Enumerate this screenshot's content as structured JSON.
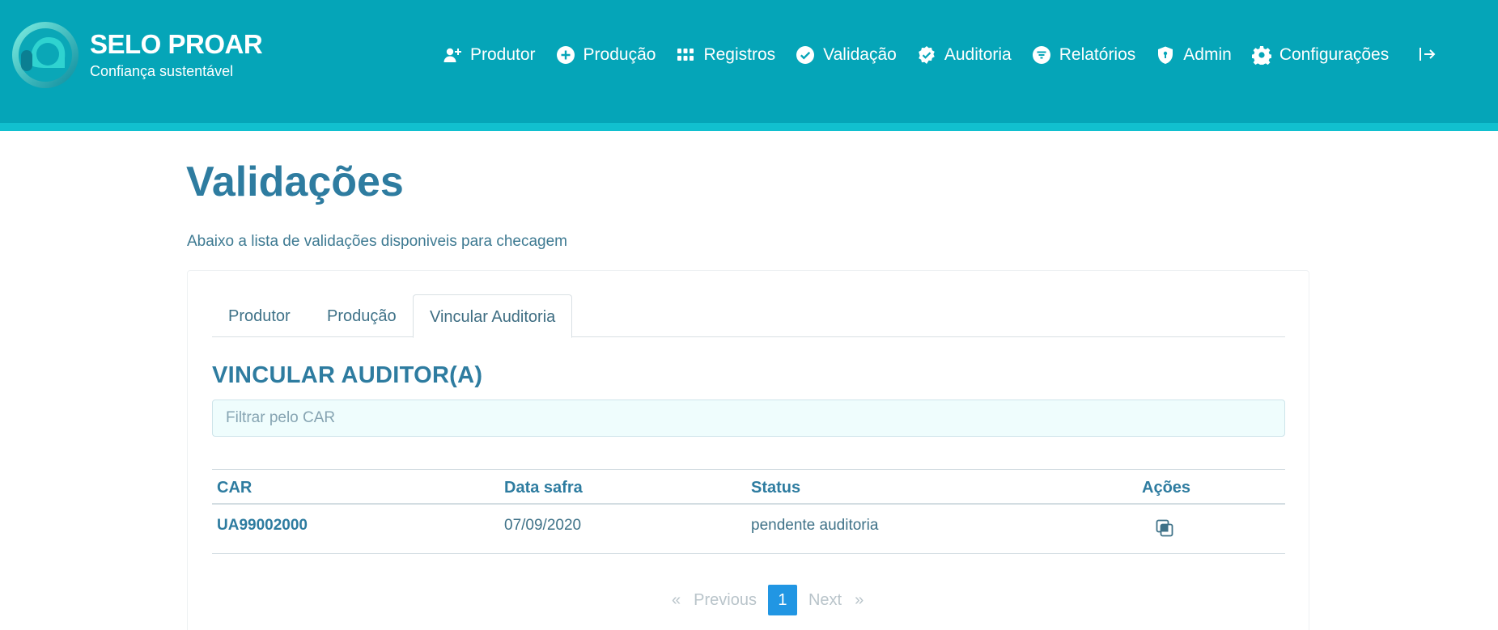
{
  "brand": {
    "title": "SELO PROAR",
    "subtitle": "Confiança sustentável",
    "colors": {
      "header": "#05a5b8",
      "accent_strip": "#11c0cf",
      "heading": "#2e7ca0",
      "page_active": "#2196e3"
    }
  },
  "nav": {
    "items": [
      {
        "label": "Produtor",
        "icon": "user-plus-icon"
      },
      {
        "label": "Produção",
        "icon": "plus-circle-icon"
      },
      {
        "label": "Registros",
        "icon": "grid-icon"
      },
      {
        "label": "Validação",
        "icon": "check-circle-icon"
      },
      {
        "label": "Auditoria",
        "icon": "badge-check-icon"
      },
      {
        "label": "Relatórios",
        "icon": "filter-circle-icon"
      },
      {
        "label": "Admin",
        "icon": "shield-icon"
      },
      {
        "label": "Configurações",
        "icon": "gear-icon"
      }
    ],
    "logout_icon": "logout-icon"
  },
  "page": {
    "title": "Validações",
    "description": "Abaixo a lista de validações disponiveis para checagem"
  },
  "tabs": [
    {
      "label": "Produtor",
      "active": false
    },
    {
      "label": "Produção",
      "active": false
    },
    {
      "label": "Vincular Auditoria",
      "active": true
    }
  ],
  "section": {
    "heading": "VINCULAR AUDITOR(A)",
    "filter_placeholder": "Filtrar pelo CAR",
    "filter_value": ""
  },
  "table": {
    "headers": [
      "CAR",
      "Data safra",
      "Status",
      "Ações"
    ],
    "rows": [
      {
        "car": "UA99002000",
        "data_safra": "07/09/2020",
        "status": "pendente auditoria",
        "action_icon": "copy-icon"
      }
    ]
  },
  "pagination": {
    "first": "«",
    "previous": "Previous",
    "current": "1",
    "next": "Next",
    "last": "»"
  }
}
